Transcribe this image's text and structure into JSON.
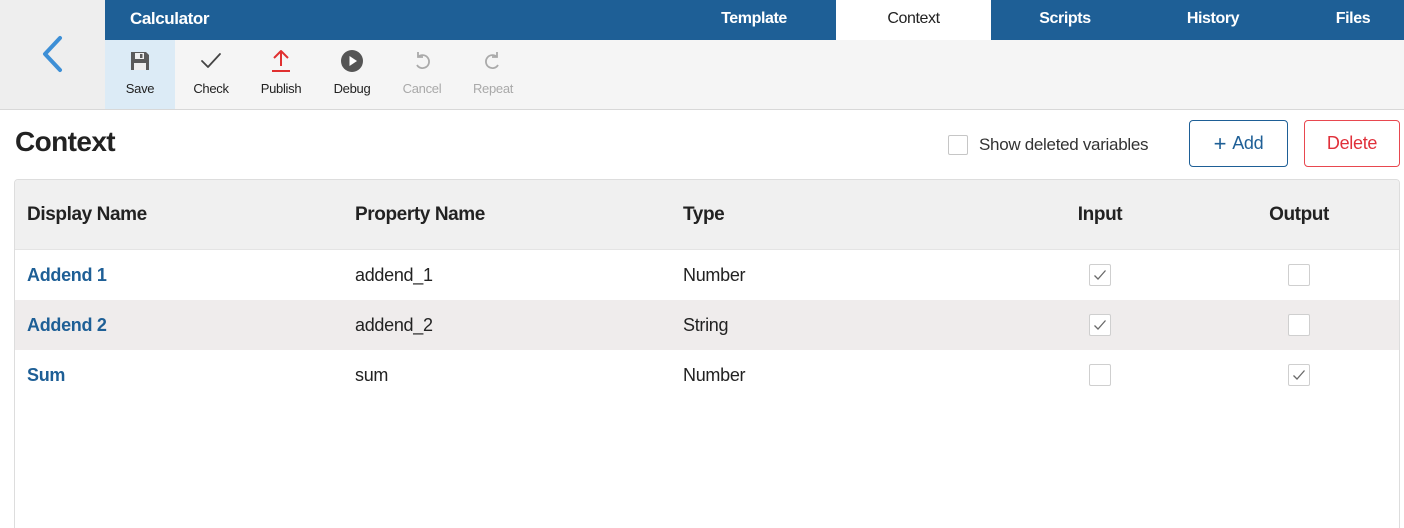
{
  "app": {
    "title": "Calculator"
  },
  "tabs": [
    {
      "label": "Template",
      "active": false
    },
    {
      "label": "Context",
      "active": true
    },
    {
      "label": "Scripts",
      "active": false
    },
    {
      "label": "History",
      "active": false
    },
    {
      "label": "Files",
      "active": false
    }
  ],
  "toolbar": {
    "save": {
      "label": "Save",
      "icon": "floppy-disk-icon",
      "selected": true
    },
    "check": {
      "label": "Check",
      "icon": "checkmark-icon"
    },
    "publish": {
      "label": "Publish",
      "icon": "upload-arrow-icon"
    },
    "debug": {
      "label": "Debug",
      "icon": "play-circle-icon"
    },
    "cancel": {
      "label": "Cancel",
      "icon": "undo-icon",
      "disabled": true
    },
    "repeat": {
      "label": "Repeat",
      "icon": "redo-icon",
      "disabled": true
    }
  },
  "page": {
    "title": "Context",
    "show_deleted_label": "Show deleted variables",
    "show_deleted_checked": false,
    "add_label": "Add",
    "delete_label": "Delete"
  },
  "table": {
    "columns": {
      "display_name": "Display Name",
      "property_name": "Property Name",
      "type": "Type",
      "input": "Input",
      "output": "Output"
    },
    "rows": [
      {
        "display_name": "Addend 1",
        "property_name": "addend_1",
        "type": "Number",
        "input": true,
        "output": false
      },
      {
        "display_name": "Addend 2",
        "property_name": "addend_2",
        "type": "String",
        "input": true,
        "output": false
      },
      {
        "display_name": "Sum",
        "property_name": "sum",
        "type": "Number",
        "input": false,
        "output": true
      }
    ]
  },
  "colors": {
    "brand_blue": "#1e5f96",
    "delete_red": "#e0303a",
    "publish_red": "#e03030",
    "selected_tool_bg": "#dcebf6"
  }
}
